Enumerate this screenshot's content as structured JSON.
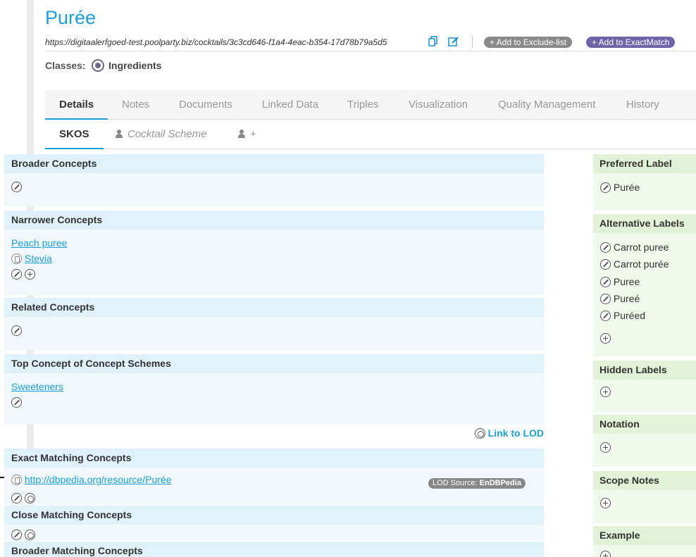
{
  "concept": {
    "title": "Purée",
    "uri": "https://digitaalerfgoed-test.poolparty.biz/cocktails/3c3cd646-f1a4-4eac-b354-17d78b79a5d5",
    "add_exclude_label": "+ Add to Exclude-list",
    "add_exactmatch_label": "+ Add to ExactMatch",
    "classes_label": "Classes:",
    "class_value": "Ingredients"
  },
  "tabs": [
    "Details",
    "Notes",
    "Documents",
    "Linked Data",
    "Triples",
    "Visualization",
    "Quality Management",
    "History"
  ],
  "subtabs": {
    "skos": "SKOS",
    "scheme": "Cocktail Scheme",
    "add": "+"
  },
  "left": {
    "broader": {
      "title": "Broader Concepts"
    },
    "narrower": {
      "title": "Narrower Concepts",
      "items": [
        "Peach puree",
        "Stevia"
      ]
    },
    "related": {
      "title": "Related Concepts"
    },
    "top_concept": {
      "title": "Top Concept of Concept Schemes",
      "items": [
        "Sweeteners"
      ]
    },
    "link_to_lod": "Link to LOD",
    "exact": {
      "title": "Exact Matching Concepts",
      "items": [
        "http://dbpedia.org/resource/Purée"
      ],
      "lod_source_label": "LOD Source:",
      "lod_source_value": "EnDBPedia"
    },
    "close": {
      "title": "Close Matching Concepts"
    },
    "broader_matching": {
      "title": "Broader Matching Concepts"
    }
  },
  "right": {
    "preferred": {
      "title": "Preferred Label",
      "items": [
        "Purée"
      ]
    },
    "alternative": {
      "title": "Alternative Labels",
      "items": [
        "Carrot puree",
        "Carrot purée",
        "Puree",
        "Pureé",
        "Puréed"
      ]
    },
    "hidden": {
      "title": "Hidden Labels"
    },
    "notation": {
      "title": "Notation"
    },
    "scope": {
      "title": "Scope Notes"
    },
    "example": {
      "title": "Example"
    }
  },
  "colors": {
    "accent": "#1a9fd9",
    "exactmatch_pill": "#6f64a8",
    "exclude_pill": "#8a8a8a"
  }
}
